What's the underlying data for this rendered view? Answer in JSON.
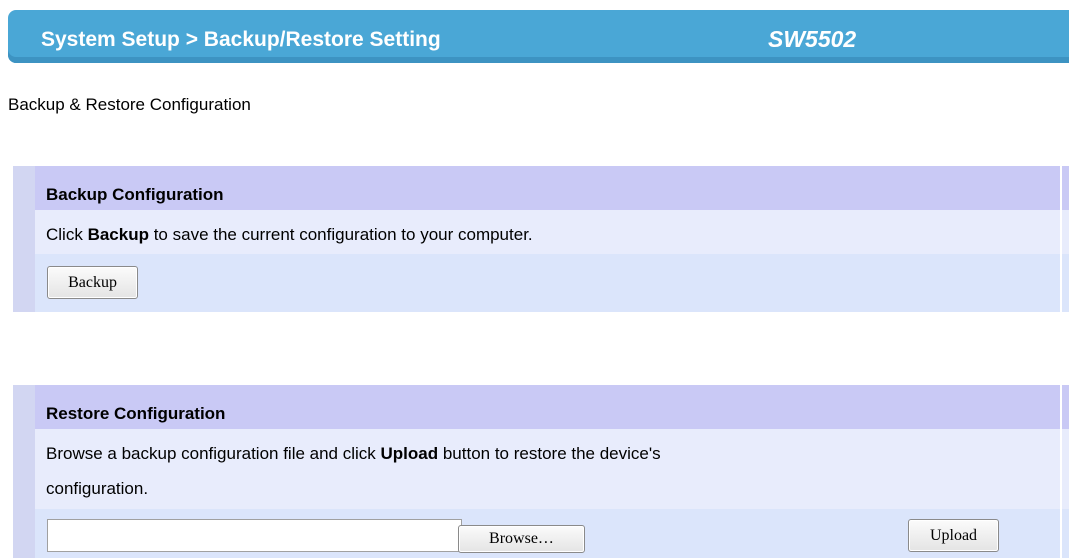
{
  "header": {
    "breadcrumb": "System Setup > Backup/Restore Setting",
    "model": "SW5502"
  },
  "page_title": "Backup & Restore Configuration",
  "backup": {
    "title": "Backup Configuration",
    "text_pre": "Click ",
    "text_bold": "Backup",
    "text_post": " to save the current configuration to your computer.",
    "button_label": "Backup"
  },
  "restore": {
    "title": "Restore Configuration",
    "text_pre": "Browse a backup configuration file and click ",
    "text_bold": "Upload",
    "text_post": " button to restore the device's",
    "text_line2": "configuration.",
    "file_value": "",
    "browse_label": "Browse…",
    "upload_label": "Upload"
  },
  "colors": {
    "header_bg": "#4aa7d6",
    "section_header_bg": "#c9c9f5",
    "section_bg": "#e8ecfc",
    "section_alt_bg": "#dbe5fb"
  }
}
